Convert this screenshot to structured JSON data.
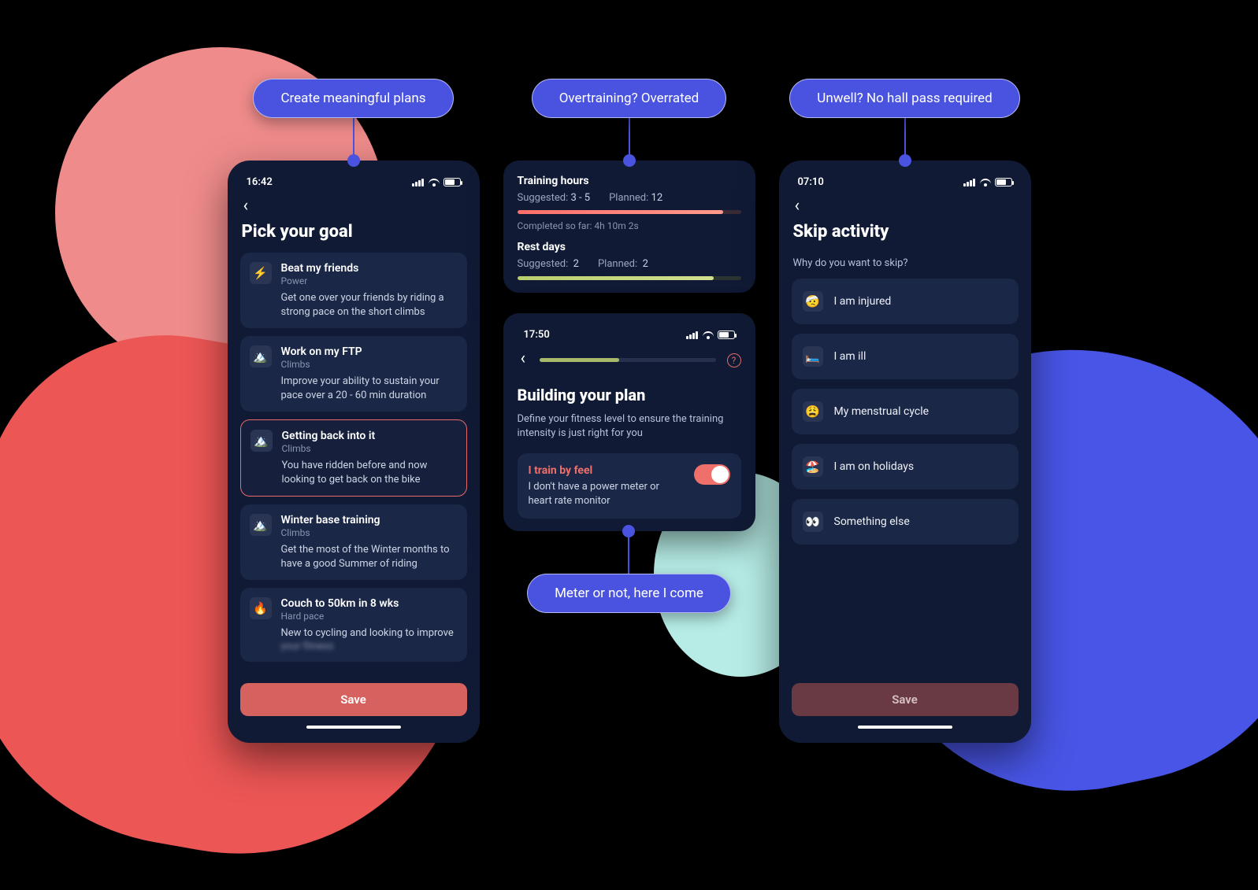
{
  "pills": {
    "left": "Create meaningful plans",
    "mid": "Overtraining? Overrated",
    "right": "Unwell? No hall pass required",
    "bottom": "Meter or not, here I come"
  },
  "screen1": {
    "time": "16:42",
    "title": "Pick your goal",
    "goals": [
      {
        "icon": "⚡",
        "title": "Beat my friends",
        "tag": "Power",
        "desc": "Get one over your friends by riding a strong pace on the short climbs"
      },
      {
        "icon": "🏔️",
        "title": "Work on my FTP",
        "tag": "Climbs",
        "desc": "Improve your ability to sustain your pace over a 20 - 60 min duration"
      },
      {
        "icon": "🏔️",
        "title": "Getting back into it",
        "tag": "Climbs",
        "desc": "You have ridden before and now looking to get back on the bike"
      },
      {
        "icon": "🏔️",
        "title": "Winter base training",
        "tag": "Climbs",
        "desc": "Get the most of the Winter months to have a good Summer of riding"
      },
      {
        "icon": "🔥",
        "title": "Couch to 50km in 8 wks",
        "tag": "Hard pace",
        "desc": "New to cycling and looking to improve",
        "desc2": "your fitness"
      }
    ],
    "save": "Save"
  },
  "training_panel": {
    "hours_title": "Training hours",
    "suggested_label": "Suggested:",
    "suggested_hours": "3 - 5",
    "planned_label": "Planned:",
    "planned_hours": "12",
    "completed_label": "Completed so far:",
    "completed_value": "4h 10m 2s",
    "rest_title": "Rest days",
    "rest_suggested": "2",
    "rest_planned": "2"
  },
  "buildplan": {
    "time": "17:50",
    "title": "Building your plan",
    "sub": "Define your fitness level to ensure the training intensity is just right for you",
    "switch_title": "I train by feel",
    "switch_sub": "I don't have a power meter or heart rate monitor"
  },
  "screen3": {
    "time": "07:10",
    "title": "Skip activity",
    "prompt": "Why do you want to skip?",
    "options": [
      {
        "icon": "🤕",
        "label": "I am injured"
      },
      {
        "icon": "🛏️",
        "label": "I am ill"
      },
      {
        "icon": "😩",
        "label": "My menstrual cycle"
      },
      {
        "icon": "🏖️",
        "label": "I am on holidays"
      },
      {
        "icon": "👀",
        "label": "Something else"
      }
    ],
    "save": "Save"
  }
}
